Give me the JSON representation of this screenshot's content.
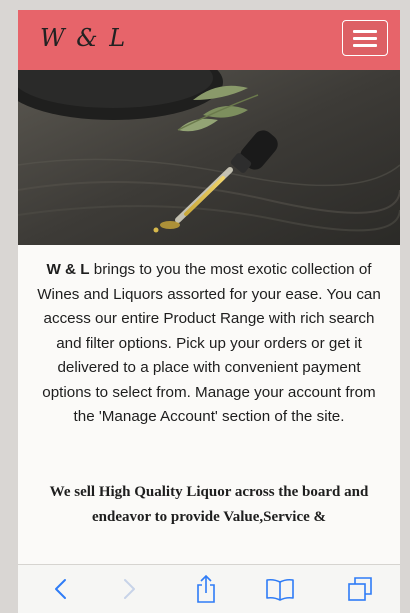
{
  "header": {
    "brand": "W & L",
    "menu_icon": "hamburger-menu-icon"
  },
  "hero": {
    "image": "dropper-bottle-oil-photo"
  },
  "intro": {
    "brand_bold": "W & L",
    "text": " brings to you the most exotic collection of Wines and Liquors assorted for your ease. You can access our entire Product Range with rich search and filter options. Pick up your orders or get it delivered to a place with convenient payment options to select from. Manage your account from the 'Manage Account' section of the site."
  },
  "tagline": {
    "text": "We sell High Quality Liquor across the board and endeavor to provide Value,Service &"
  },
  "browser_toolbar": {
    "icons": [
      "back-icon",
      "forward-icon",
      "share-icon",
      "bookmarks-icon",
      "tabs-icon"
    ],
    "colors": {
      "active": "#2f7cf6",
      "inactive": "#c7d3e8"
    }
  },
  "colors": {
    "navbar": "#e7646a",
    "page_bg": "#fbfaf8"
  }
}
